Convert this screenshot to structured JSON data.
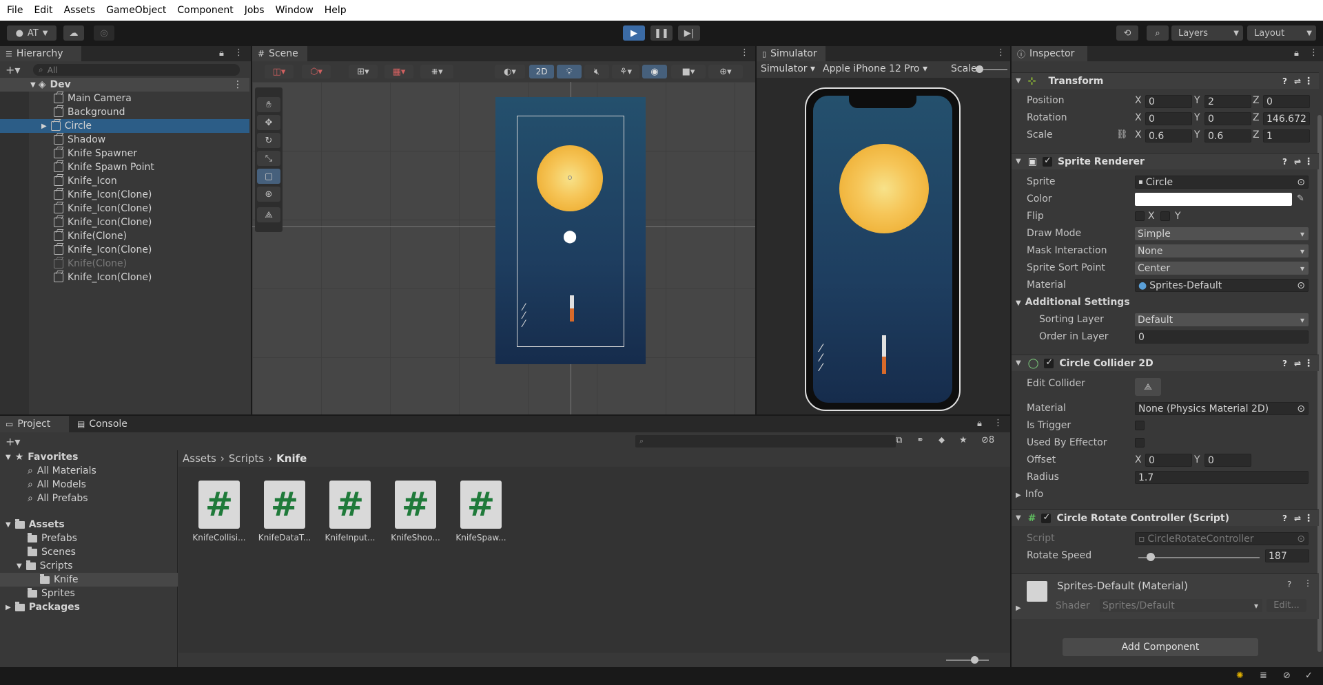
{
  "menu": [
    "File",
    "Edit",
    "Assets",
    "GameObject",
    "Component",
    "Jobs",
    "Window",
    "Help"
  ],
  "toolbar": {
    "account": "AT",
    "layers": "Layers",
    "layout": "Layout"
  },
  "hierarchy": {
    "tab": "Hierarchy",
    "search_placeholder": "All",
    "scene": "Dev",
    "items": [
      {
        "label": "Main Camera"
      },
      {
        "label": "Background"
      },
      {
        "label": "Circle"
      },
      {
        "label": "Shadow"
      },
      {
        "label": "Knife Spawner"
      },
      {
        "label": "Knife Spawn Point"
      },
      {
        "label": "Knife_Icon"
      },
      {
        "label": "Knife_Icon(Clone)"
      },
      {
        "label": "Knife_Icon(Clone)"
      },
      {
        "label": "Knife_Icon(Clone)"
      },
      {
        "label": "Knife(Clone)"
      },
      {
        "label": "Knife_Icon(Clone)"
      },
      {
        "label": "Knife(Clone)"
      },
      {
        "label": "Knife_Icon(Clone)"
      }
    ]
  },
  "scene": {
    "tab": "Scene",
    "mode_2d": "2D"
  },
  "simulator": {
    "tab": "Simulator",
    "mode": "Simulator",
    "device": "Apple iPhone 12 Pro",
    "scale_label": "Scale"
  },
  "inspector": {
    "tab": "Inspector",
    "transform": {
      "title": "Transform",
      "position_label": "Position",
      "rotation_label": "Rotation",
      "scale_label": "Scale",
      "position": {
        "x": "0",
        "y": "2",
        "z": "0"
      },
      "rotation": {
        "x": "0",
        "y": "0",
        "z": "146.672"
      },
      "scale": {
        "x": "0.6",
        "y": "0.6",
        "z": "1"
      }
    },
    "sprite_renderer": {
      "title": "Sprite Renderer",
      "sprite_label": "Sprite",
      "sprite": "Circle",
      "color_label": "Color",
      "flip_label": "Flip",
      "flip_x": "X",
      "flip_y": "Y",
      "draw_mode_label": "Draw Mode",
      "draw_mode": "Simple",
      "mask_label": "Mask Interaction",
      "mask": "None",
      "sort_point_label": "Sprite Sort Point",
      "sort_point": "Center",
      "material_label": "Material",
      "material": "Sprites-Default",
      "additional_label": "Additional Settings",
      "sorting_layer_label": "Sorting Layer",
      "sorting_layer": "Default",
      "order_label": "Order in Layer",
      "order": "0"
    },
    "collider": {
      "title": "Circle Collider 2D",
      "edit_label": "Edit Collider",
      "material_label": "Material",
      "material": "None (Physics Material 2D)",
      "trigger_label": "Is Trigger",
      "effector_label": "Used By Effector",
      "offset_label": "Offset",
      "offset": {
        "x": "0",
        "y": "0"
      },
      "radius_label": "Radius",
      "radius": "1.7",
      "info_label": "Info"
    },
    "script": {
      "title": "Circle Rotate Controller (Script)",
      "script_label": "Script",
      "script": "CircleRotateController",
      "speed_label": "Rotate Speed",
      "speed": "187",
      "speed_fraction": 0.1
    },
    "material": {
      "title": "Sprites-Default (Material)",
      "shader_label": "Shader",
      "shader": "Sprites/Default",
      "edit": "Edit..."
    },
    "add_component": "Add Component"
  },
  "project": {
    "tab_project": "Project",
    "tab_console": "Console",
    "hidden_count": "8",
    "favorites": "Favorites",
    "fav_items": [
      "All Materials",
      "All Models",
      "All Prefabs"
    ],
    "assets": "Assets",
    "asset_folders": [
      "Prefabs",
      "Scenes",
      "Scripts",
      "Knife",
      "Sprites"
    ],
    "packages": "Packages",
    "breadcrumb": [
      "Assets",
      "Scripts",
      "Knife"
    ],
    "files": [
      "KnifeCollisi...",
      "KnifeDataT...",
      "KnifeInput...",
      "KnifeShoo...",
      "KnifeSpaw..."
    ]
  }
}
